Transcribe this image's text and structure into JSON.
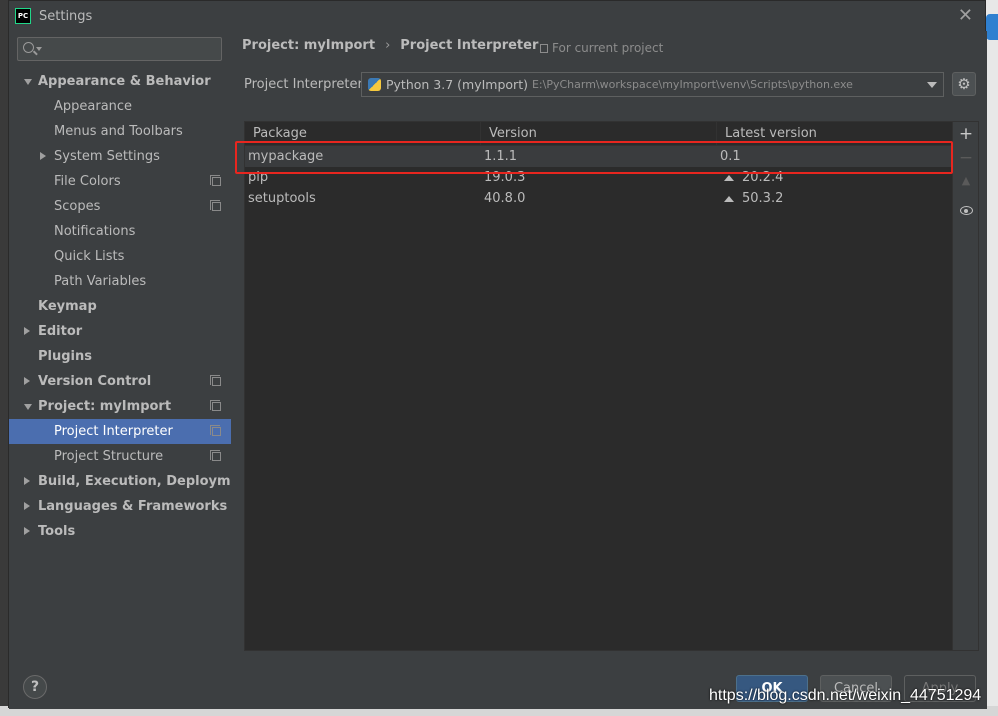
{
  "window": {
    "title": "Settings",
    "app_icon_text": "PC"
  },
  "sidebar": {
    "search_placeholder": "",
    "items": [
      {
        "label": "Appearance & Behavior",
        "level": 0,
        "arrow": "down",
        "bold": true,
        "copy": false
      },
      {
        "label": "Appearance",
        "level": 1,
        "arrow": "",
        "bold": false,
        "copy": false
      },
      {
        "label": "Menus and Toolbars",
        "level": 1,
        "arrow": "",
        "bold": false,
        "copy": false
      },
      {
        "label": "System Settings",
        "level": 1,
        "arrow": "right",
        "bold": false,
        "copy": false
      },
      {
        "label": "File Colors",
        "level": 1,
        "arrow": "",
        "bold": false,
        "copy": true
      },
      {
        "label": "Scopes",
        "level": 1,
        "arrow": "",
        "bold": false,
        "copy": true
      },
      {
        "label": "Notifications",
        "level": 1,
        "arrow": "",
        "bold": false,
        "copy": false
      },
      {
        "label": "Quick Lists",
        "level": 1,
        "arrow": "",
        "bold": false,
        "copy": false
      },
      {
        "label": "Path Variables",
        "level": 1,
        "arrow": "",
        "bold": false,
        "copy": false
      },
      {
        "label": "Keymap",
        "level": 0,
        "arrow": "",
        "bold": true,
        "copy": false
      },
      {
        "label": "Editor",
        "level": 0,
        "arrow": "right",
        "bold": true,
        "copy": false
      },
      {
        "label": "Plugins",
        "level": 0,
        "arrow": "",
        "bold": true,
        "copy": false
      },
      {
        "label": "Version Control",
        "level": 0,
        "arrow": "right",
        "bold": true,
        "copy": true
      },
      {
        "label": "Project: myImport",
        "level": 0,
        "arrow": "down",
        "bold": true,
        "copy": true
      },
      {
        "label": "Project Interpreter",
        "level": 1,
        "arrow": "",
        "bold": false,
        "copy": true,
        "selected": true
      },
      {
        "label": "Project Structure",
        "level": 1,
        "arrow": "",
        "bold": false,
        "copy": true
      },
      {
        "label": "Build, Execution, Deployment",
        "level": 0,
        "arrow": "right",
        "bold": true,
        "copy": false
      },
      {
        "label": "Languages & Frameworks",
        "level": 0,
        "arrow": "right",
        "bold": true,
        "copy": false
      },
      {
        "label": "Tools",
        "level": 0,
        "arrow": "right",
        "bold": true,
        "copy": false
      }
    ]
  },
  "main": {
    "breadcrumb": {
      "parent": "Project: myImport",
      "separator": "›",
      "current": "Project Interpreter"
    },
    "scope_note": "For current project",
    "interpreter": {
      "label": "Project Interpreter:",
      "name": "Python 3.7 (myImport)",
      "path": "E:\\PyCharm\\workspace\\myImport\\venv\\Scripts\\python.exe"
    },
    "table": {
      "headers": [
        "Package",
        "Version",
        "Latest version"
      ],
      "rows": [
        {
          "package": "mypackage",
          "version": "1.1.1",
          "latest": "0.1",
          "upgrade": false
        },
        {
          "package": "pip",
          "version": "19.0.3",
          "latest": "20.2.4",
          "upgrade": true
        },
        {
          "package": "setuptools",
          "version": "40.8.0",
          "latest": "50.3.2",
          "upgrade": true
        }
      ]
    },
    "tools": {
      "add": "+",
      "remove": "−"
    }
  },
  "footer": {
    "help": "?",
    "ok": "OK",
    "cancel": "Cancel",
    "apply": "Apply"
  },
  "watermark": "https://blog.csdn.net/weixin_44751294",
  "colors": {
    "selection": "#4b6eaf",
    "highlight_box": "#e8261f",
    "ok_button": "#365880"
  }
}
